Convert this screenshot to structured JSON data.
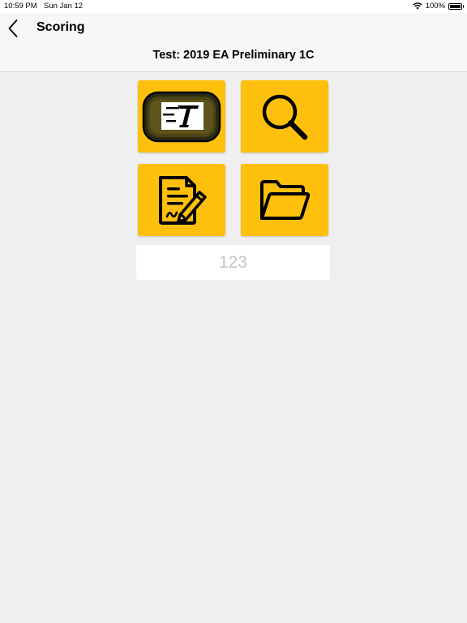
{
  "status_bar": {
    "time": "10:59 PM",
    "date": "Sun Jan 12",
    "battery": "100%",
    "wifi_icon": "wifi-icon",
    "battery_icon": "battery-icon"
  },
  "nav": {
    "back_icon": "chevron-left-icon",
    "title": "Scoring",
    "test_title": "Test: 2019 EA Preliminary 1C"
  },
  "tiles": [
    {
      "icon": "scoreboard-t-icon"
    },
    {
      "icon": "search-icon"
    },
    {
      "icon": "document-sign-icon"
    },
    {
      "icon": "folder-icon"
    }
  ],
  "code_input": {
    "value": "",
    "placeholder": "123"
  },
  "colors": {
    "tile_background": "#fec00d",
    "page_background": "#efefef",
    "nav_background": "#f7f7f7"
  }
}
